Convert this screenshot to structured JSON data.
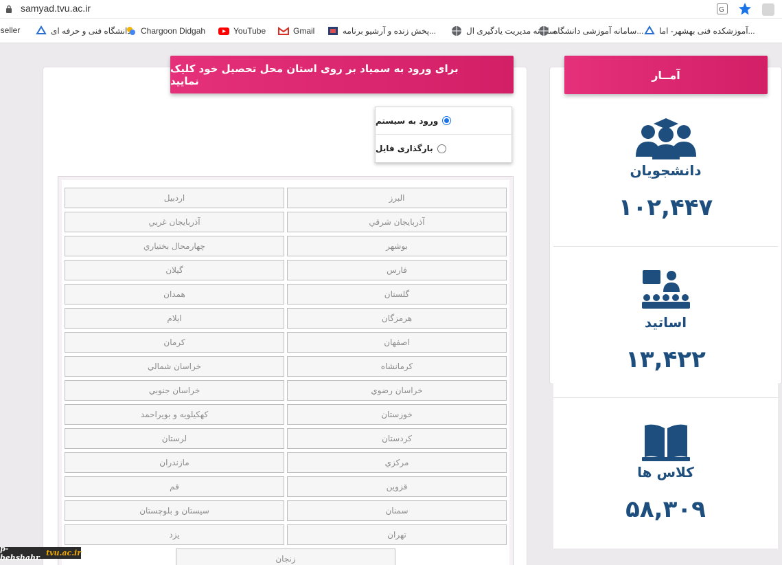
{
  "browser": {
    "url": "samyad.tvu.ac.ir"
  },
  "bookmarks": [
    {
      "label": "eseller",
      "icon": "none"
    },
    {
      "label": "دانشگاه فنی و حرفه ای",
      "icon": "tvu-logo-icon"
    },
    {
      "label": "Chargoon Didgah",
      "icon": "chargoon-icon"
    },
    {
      "label": "YouTube",
      "icon": "youtube-icon"
    },
    {
      "label": "Gmail",
      "icon": "gmail-icon"
    },
    {
      "label": "پخش زنده و آرشیو برنامه...",
      "icon": "broadcast-icon"
    },
    {
      "label": "سامانه مدیریت یادگیری ال...",
      "icon": "globe-icon"
    },
    {
      "label": "سامانه آموزشی دانشگاه...",
      "icon": "globe-icon"
    },
    {
      "label": "آموزشکده فنی بهشهر- اما...",
      "icon": "tvu-logo-icon"
    }
  ],
  "notice": "برای ورود به سمیاد بر روی استان محل تحصیل خود کلیک نمایید",
  "options": [
    {
      "label": "ورود به سیستم",
      "checked": true
    },
    {
      "label": "بارگذاری فایل",
      "checked": false
    }
  ],
  "provinces": {
    "right": [
      "البرز",
      "آذربایجان شرقي",
      "بوشهر",
      "فارس",
      "گلستان",
      "هرمزگان",
      "اصفهان",
      "كرمانشاه",
      "خراسان رضوي",
      "خوزستان",
      "كردستان",
      "مركزي",
      "قزوين",
      "سمنان",
      "تهران"
    ],
    "left": [
      "اردبيل",
      "آذربايجان غربي",
      "چهارمحال بختياري",
      "گيلان",
      "همدان",
      "ايلام",
      "كرمان",
      "خراسان شمالي",
      "خراسان جنوبي",
      "كهكيلويه و بويراحمد",
      "لرستان",
      "مازندران",
      "قم",
      "سيستان و بلوچستان",
      "يزد"
    ],
    "last": "زنجان"
  },
  "stats": {
    "header": "آمــار",
    "items": [
      {
        "label": "دانشجویان",
        "value": "۱۰۲,۴۴۷",
        "icon": "students-icon"
      },
      {
        "label": "اساتید",
        "value": "۱۳,۴۲۲",
        "icon": "teacher-icon"
      },
      {
        "label": "کلاس ها",
        "value": "۵۸,۳۰۹",
        "icon": "book-icon"
      }
    ]
  },
  "watermark": {
    "prefix": "p-behshahr.",
    "accent": "tvu.ac.ir"
  },
  "colors": {
    "accent": "#e02a72",
    "stat_blue": "#1d4e7d"
  }
}
